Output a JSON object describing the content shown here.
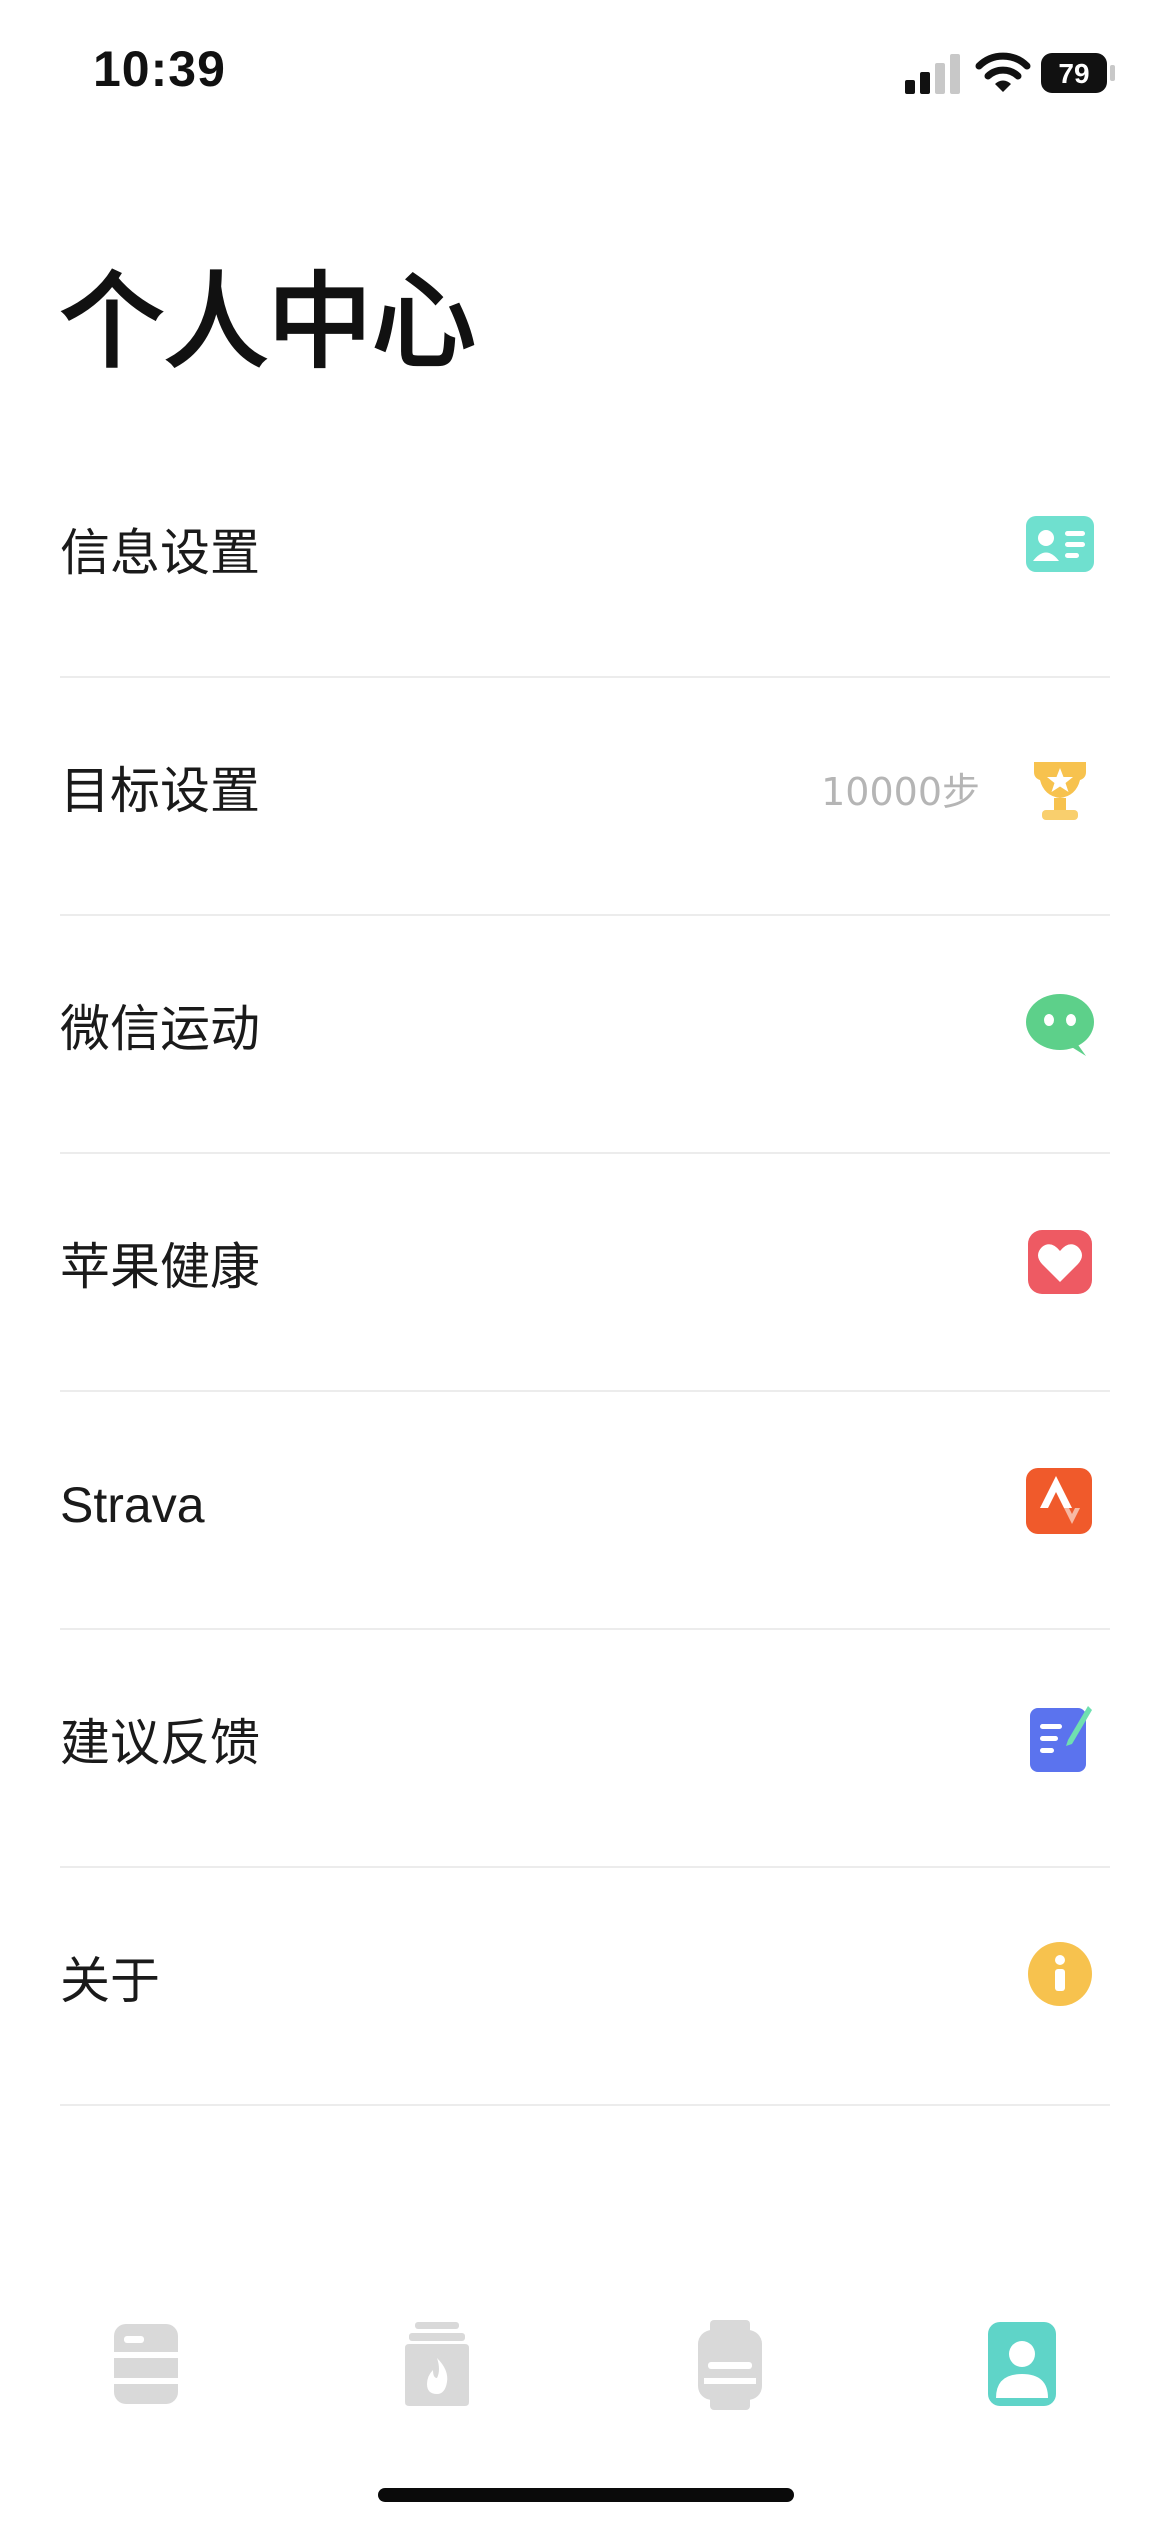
{
  "status_bar": {
    "time": "10:39",
    "battery_level": "79"
  },
  "page": {
    "title": "个人中心"
  },
  "menu": {
    "items": [
      {
        "label": "信息设置",
        "icon": "profile-card-icon"
      },
      {
        "label": "目标设置",
        "value": "10000步",
        "icon": "trophy-icon"
      },
      {
        "label": "微信运动",
        "icon": "wechat-icon"
      },
      {
        "label": "苹果健康",
        "icon": "heart-icon"
      },
      {
        "label": "Strava",
        "icon": "strava-icon"
      },
      {
        "label": "建议反馈",
        "icon": "feedback-note-icon"
      },
      {
        "label": "关于",
        "icon": "info-icon"
      }
    ]
  },
  "tab_bar": {
    "tabs": [
      {
        "icon": "records-icon",
        "active": false
      },
      {
        "icon": "calories-icon",
        "active": false
      },
      {
        "icon": "watch-icon",
        "active": false
      },
      {
        "icon": "profile-icon",
        "active": true
      }
    ],
    "active_color": "#5fd4c8",
    "inactive_color": "#d6d6d6"
  }
}
